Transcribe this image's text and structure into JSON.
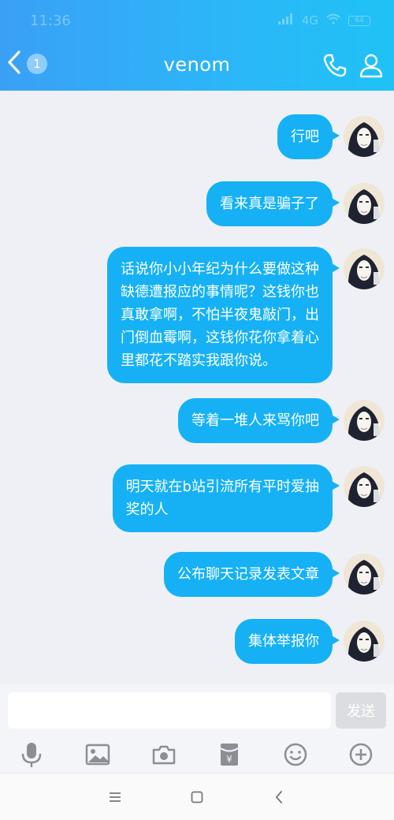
{
  "status_bar": {
    "time": "11:36",
    "network": "4G",
    "battery": "64"
  },
  "header": {
    "title": "venom",
    "unread_badge": "1"
  },
  "messages": [
    {
      "text": "行吧"
    },
    {
      "text": "看来真是骗子了"
    },
    {
      "text_lines": [
        "话说你小小年纪为什么要做这种",
        "缺德遭报应的事情呢？这钱你也",
        "真敢拿啊，不怕半夜鬼敲门，出",
        "门倒血霉啊，这钱你花你拿着心",
        "里都花不踏实我跟你说。"
      ]
    },
    {
      "text": "等着一堆人来骂你吧"
    },
    {
      "text_lines": [
        "明天就在b站引流所有平时爱抽",
        "奖的人"
      ]
    },
    {
      "text": "公布聊天记录发表文章"
    },
    {
      "text": "集体举报你"
    }
  ],
  "input": {
    "value": "",
    "placeholder": ""
  },
  "send_button": {
    "label": "发送"
  },
  "toolbar": {
    "items": [
      "mic-icon",
      "image-icon",
      "camera-icon",
      "red-packet-icon",
      "emoji-icon",
      "plus-icon"
    ],
    "red_packet_symbol": "¥"
  },
  "navbar": {
    "items": [
      "menu-icon",
      "home-icon",
      "back-icon"
    ]
  },
  "colors": {
    "header_start": "#3aa0f6",
    "header_end": "#1fc2f5",
    "bubble": "#16b1f4",
    "background": "#eef0f6"
  }
}
